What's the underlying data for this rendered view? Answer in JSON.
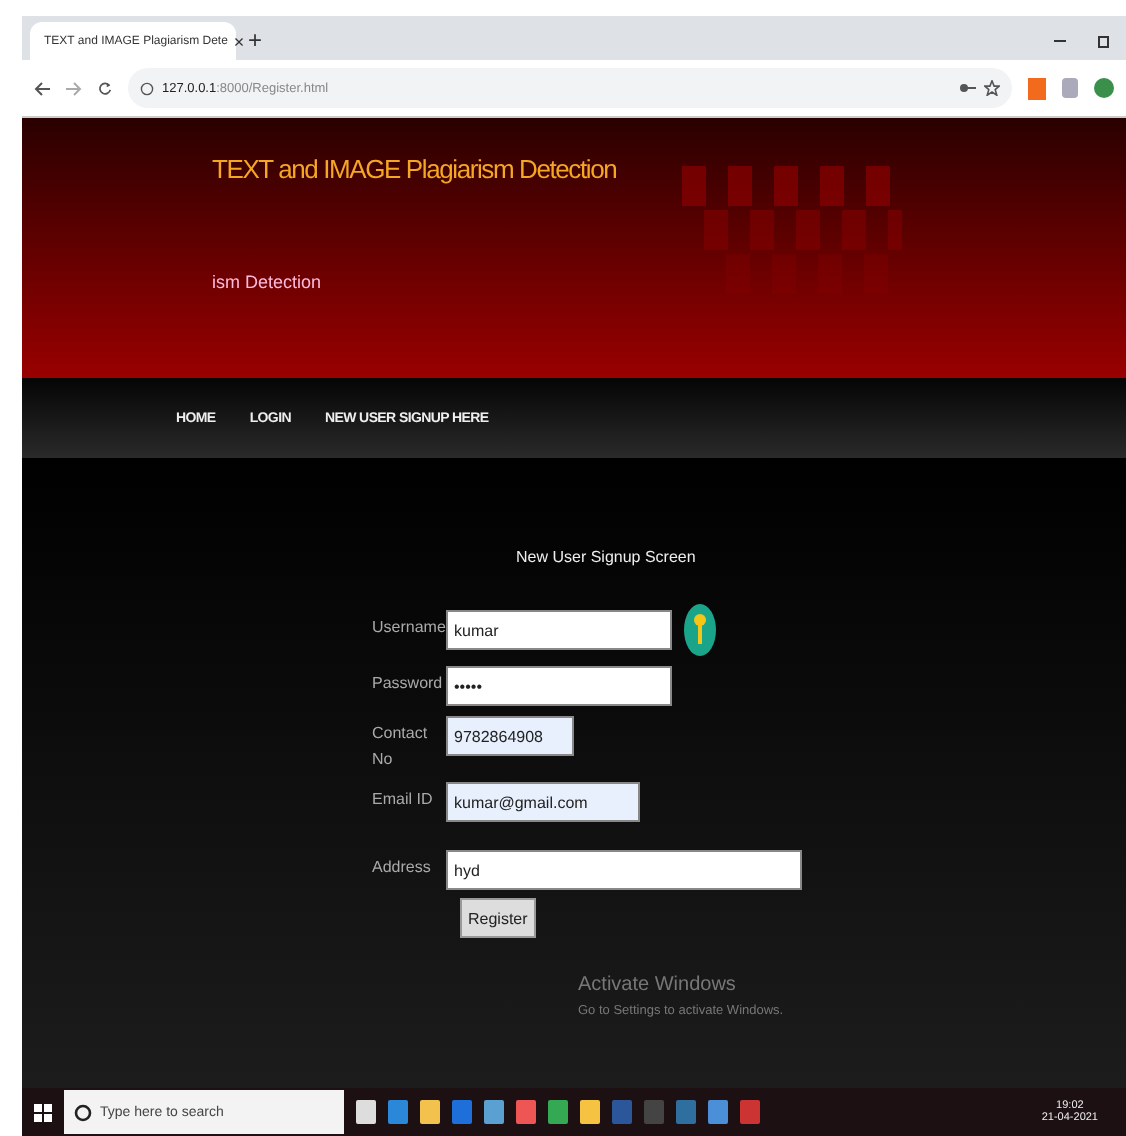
{
  "browser": {
    "tab_title": "TEXT and IMAGE Plagiarism Dete",
    "tab_close": "×",
    "new_tab": "+",
    "url_host": "127.0.0.1",
    "url_path": ":8000/Register.html"
  },
  "header": {
    "title": "TEXT and IMAGE Plagiarism Detection",
    "subtitle": "ism Detection"
  },
  "nav": [
    {
      "label": "HOME"
    },
    {
      "label": "LOGIN"
    },
    {
      "label": "NEW USER SIGNUP HERE"
    }
  ],
  "form": {
    "title": "New User Signup Screen",
    "fields": [
      {
        "label": "Username",
        "value": "kumar",
        "autofilled": false,
        "key_icon": true
      },
      {
        "label": "Password",
        "value": "•••••",
        "autofilled": false,
        "key_icon": false
      },
      {
        "label": "Contact No",
        "value": "9782864908",
        "autofilled": true,
        "key_icon": false
      },
      {
        "label": "Email ID",
        "value": "kumar@gmail.com",
        "autofilled": true,
        "key_icon": false
      },
      {
        "label": "Address",
        "value": "hyd",
        "autofilled": false,
        "key_icon": false
      }
    ],
    "button": "Register"
  },
  "activation": {
    "title": "Activate Windows",
    "message": "Go to Settings to activate Windows."
  },
  "taskbar": {
    "search_placeholder": "Type here to search",
    "time": "19:02",
    "date": "21-04-2021"
  }
}
